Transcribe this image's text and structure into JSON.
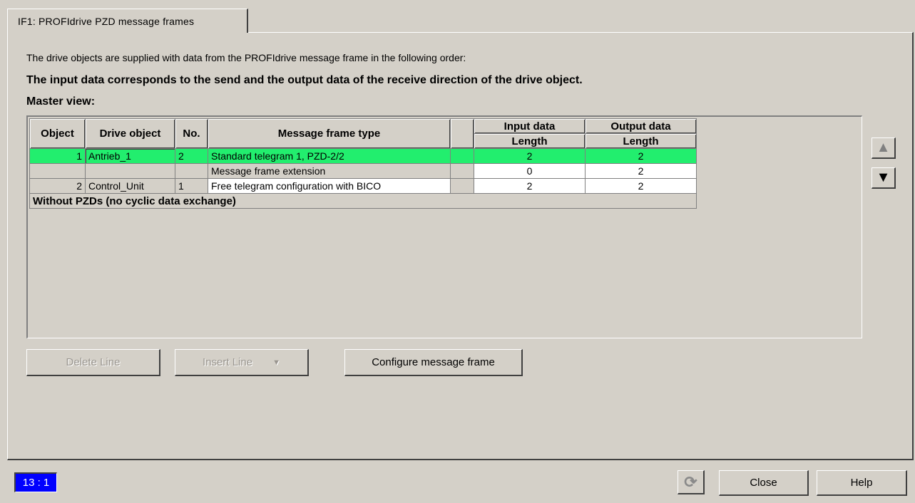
{
  "tab": {
    "label": "IF1:  PROFIdrive  PZD message frames"
  },
  "intro": {
    "line1": "The drive objects are supplied with data from the PROFIdrive message frame in the following order:",
    "line2": "The input data corresponds to the send and the output data of the receive direction of the drive object.",
    "line3": "Master view:"
  },
  "table": {
    "headers": {
      "object": "Object",
      "drive_object": "Drive object",
      "no": "No.",
      "frame_type": "Message frame type",
      "input_data": "Input data",
      "output_data": "Output data",
      "input_sub": "Length",
      "output_sub": "Length"
    },
    "rows": [
      {
        "object": "1",
        "drive_object": "Antrieb_1",
        "no": "2",
        "frame_type": "Standard telegram 1, PZD-2/2",
        "input_length": "2",
        "output_length": "2",
        "selected": true
      },
      {
        "object": "",
        "drive_object": "",
        "no": "",
        "frame_type": "Message frame extension",
        "input_length": "0",
        "output_length": "2",
        "selected": false
      },
      {
        "object": "2",
        "drive_object": "Control_Unit",
        "no": "1",
        "frame_type": "Free telegram configuration with BICO",
        "input_length": "2",
        "output_length": "2",
        "selected": false
      }
    ],
    "footer": "Without PZDs (no cyclic data exchange)"
  },
  "buttons": {
    "delete_line": "Delete Line",
    "insert_line": "Insert Line",
    "configure": "Configure message frame",
    "close": "Close",
    "help": "Help"
  },
  "status": {
    "position": "13 : 1"
  },
  "colors": {
    "selected_row": "#22ee6e",
    "status_bg": "#0000ff",
    "dialog_bg": "#d4d0c8"
  },
  "icons": {
    "scroll_up": "triangle-up-icon",
    "scroll_down": "triangle-down-icon",
    "refresh": "refresh-icon",
    "dropdown": "chevron-down-icon"
  }
}
